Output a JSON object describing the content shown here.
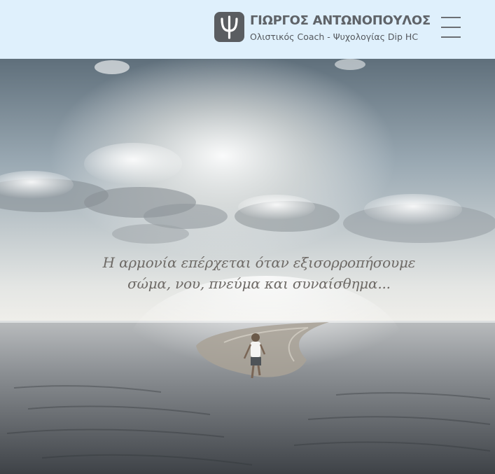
{
  "header": {
    "brand_name": "ΓΙΩΡΓΟΣ ΑΝΤΩΝΟΠΟΥΛΟΣ",
    "tagline": "Ολιστικός Coach - Ψυχολογίας Dip HC",
    "logo_icon": "psi-icon",
    "menu_icon": "hamburger-menu-icon"
  },
  "hero": {
    "quote_line1": "Η αρμονία επέρχεται όταν εξισορροπήσουμε",
    "quote_line2": "σώμα, νου, πνεύμα και συναίσθημα...",
    "image": "child-running-on-beach-photo"
  },
  "colors": {
    "header_bg": "#dff0fc",
    "logo_bg": "#5a5d61",
    "text": "#5f6368"
  }
}
